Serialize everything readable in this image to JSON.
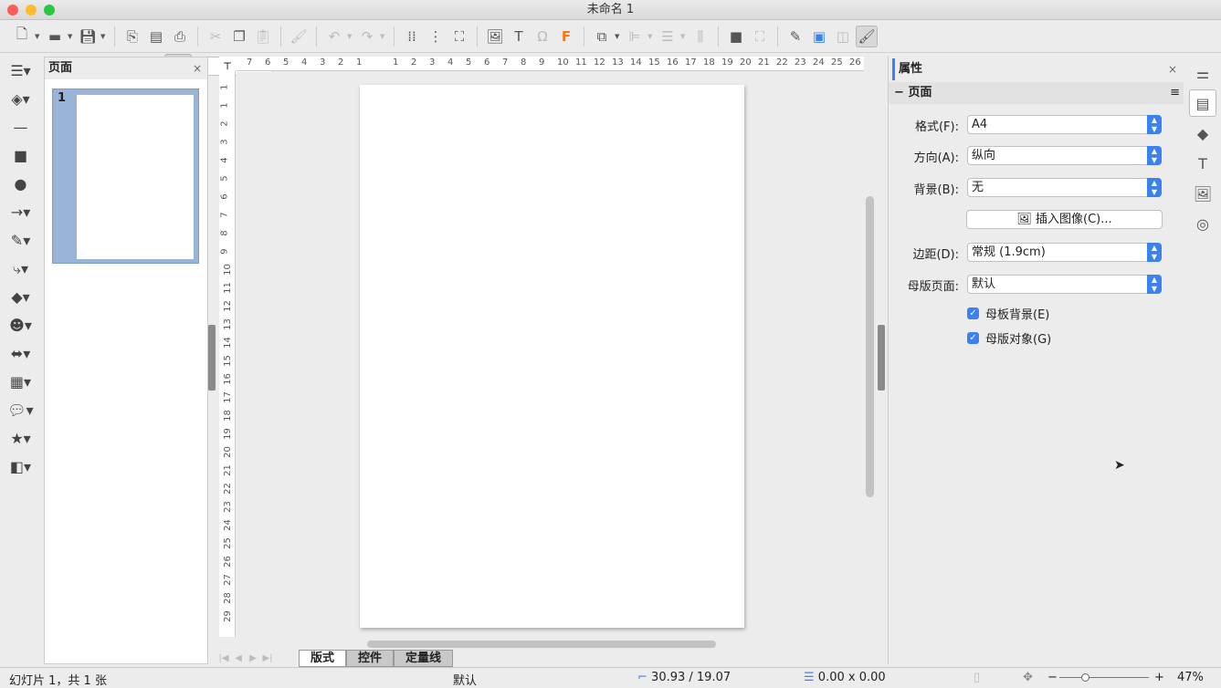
{
  "window": {
    "title": "未命名 1"
  },
  "toolbar": {
    "icons": [
      "new-document",
      "open",
      "save",
      "import",
      "export-pdf",
      "print",
      "cut",
      "copy",
      "paste",
      "clone-formatting",
      "undo",
      "redo",
      "grid",
      "helplines",
      "zoom-page",
      "insert-image",
      "insert-textbox",
      "special-character",
      "fontwork",
      "transformations",
      "align",
      "arrange",
      "distribute",
      "shadow",
      "crop",
      "filter",
      "point-edit",
      "extrusion",
      "draw-functions"
    ]
  },
  "pages_panel": {
    "title": "页面",
    "close": "×",
    "thumbnail_number": "1"
  },
  "rulers": {
    "horizontal": [
      "7",
      "6",
      "5",
      "4",
      "3",
      "2",
      "1",
      "1",
      "2",
      "3",
      "4",
      "5",
      "6",
      "7",
      "8",
      "9",
      "10",
      "11",
      "12",
      "13",
      "14",
      "15",
      "16",
      "17",
      "18",
      "19",
      "20",
      "21",
      "22",
      "23",
      "24",
      "25",
      "26"
    ],
    "vertical": [
      "1",
      "1",
      "2",
      "3",
      "4",
      "5",
      "6",
      "7",
      "8",
      "9",
      "10",
      "11",
      "12",
      "13",
      "14",
      "15",
      "16",
      "17",
      "18",
      "19",
      "20",
      "21",
      "22",
      "23",
      "24",
      "25",
      "26",
      "27",
      "28",
      "29"
    ]
  },
  "layer_tabs": [
    {
      "label": "版式",
      "active": true
    },
    {
      "label": "控件",
      "active": false
    },
    {
      "label": "定量线",
      "active": false
    }
  ],
  "properties": {
    "title": "属性",
    "close": "×",
    "section": "页面",
    "collapse": "−",
    "menu": "≡",
    "format": {
      "label": "格式(F):",
      "value": "A4"
    },
    "orientation": {
      "label": "方向(A):",
      "value": "纵向"
    },
    "background": {
      "label": "背景(B):",
      "value": "无"
    },
    "insert_image": "插入图像(C)...",
    "margins": {
      "label": "边距(D):",
      "value": "常规 (1.9cm)"
    },
    "master_page": {
      "label": "母版页面:",
      "value": "默认"
    },
    "master_background": {
      "label": "母板背景(E)",
      "checked": true
    },
    "master_objects": {
      "label": "母版对象(G)",
      "checked": true
    }
  },
  "status": {
    "slide": "幻灯片 1，共 1 张",
    "master": "默认",
    "position": "30.93 / 19.07",
    "size": "0.00 x 0.00",
    "zoom": "47%",
    "zoom_fraction": 0.47
  },
  "colors": {
    "accent": "#3b82f0",
    "thumb_selected": "#9ab4d8"
  }
}
